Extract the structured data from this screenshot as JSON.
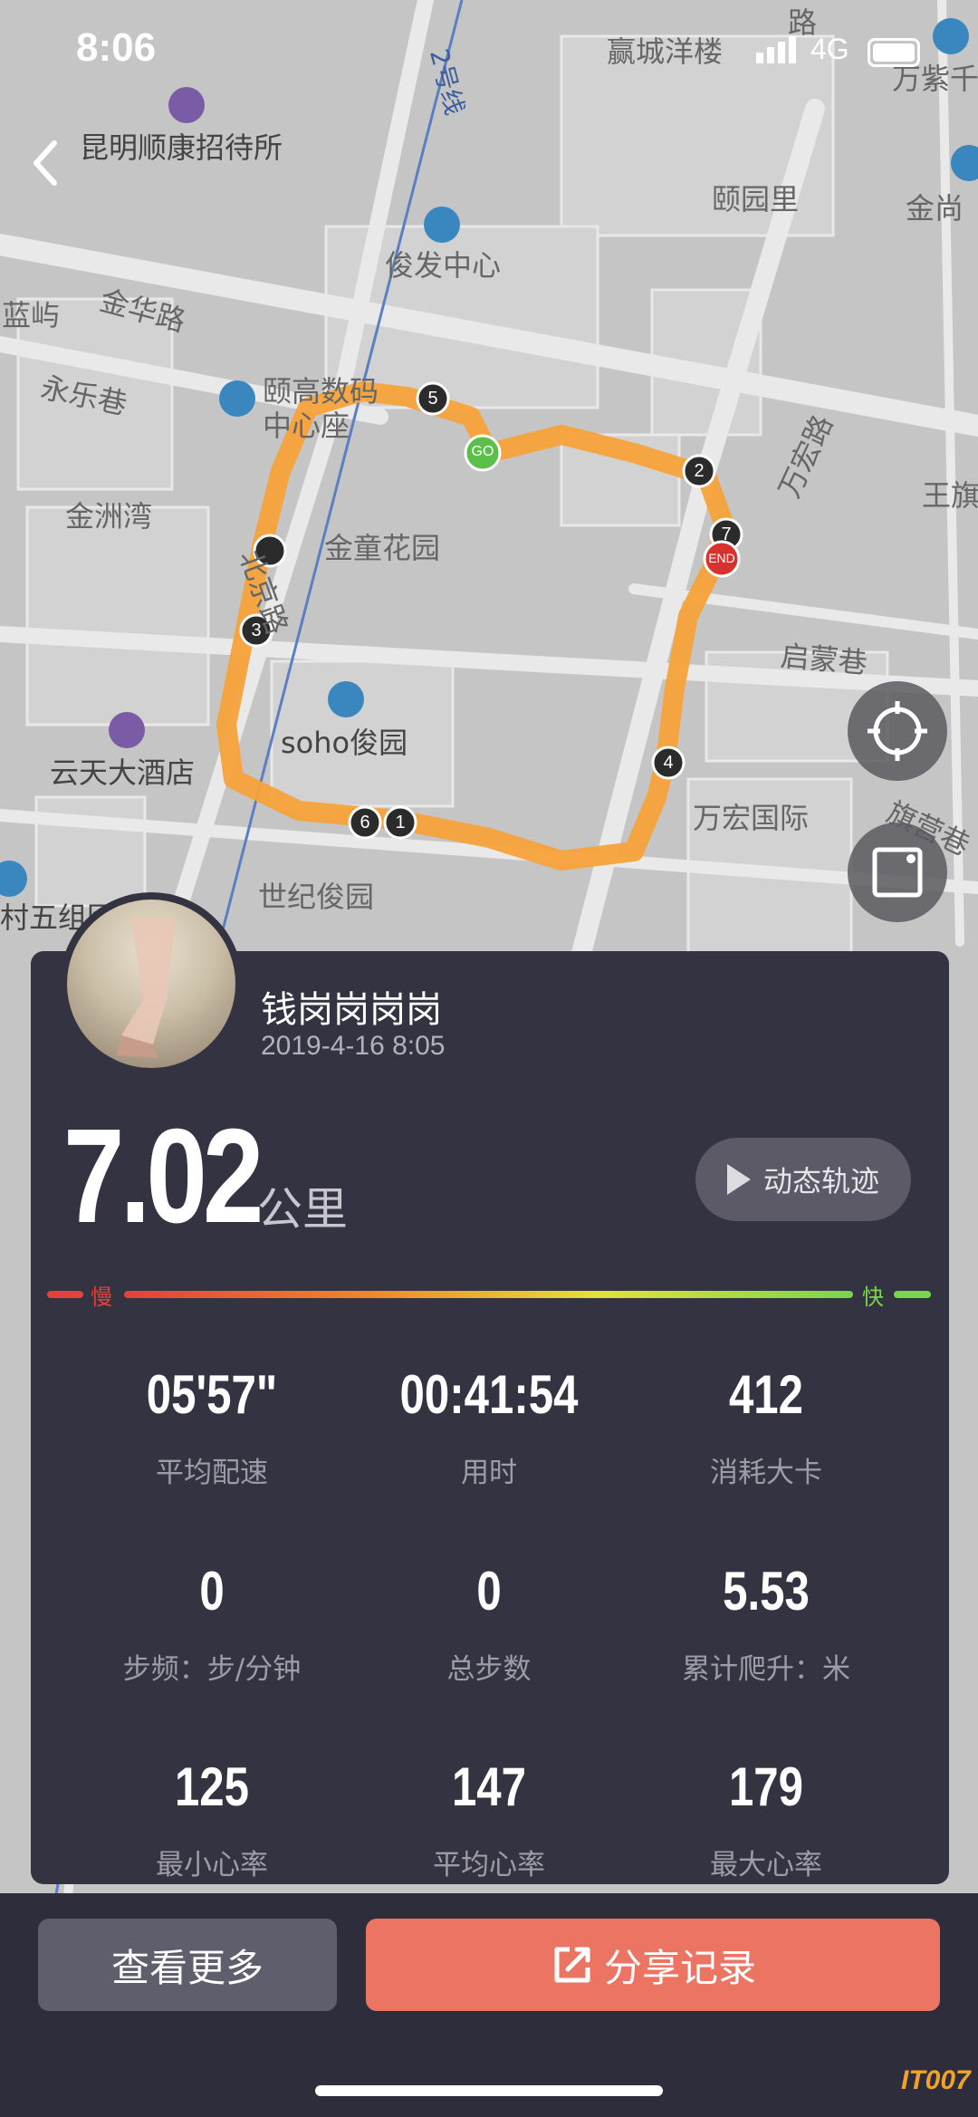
{
  "status_bar": {
    "time": "8:06",
    "network": "4G"
  },
  "map": {
    "labels": [
      "昆明顺康招待所",
      "俊发中心",
      "颐园里",
      "金尚",
      "万紫千",
      "赢城洋楼",
      "蓝屿",
      "金华路",
      "永乐巷",
      "颐高数码",
      "中心座",
      "金童花园",
      "金洲湾",
      "北京路",
      "万宏路",
      "王旗",
      "启蒙巷",
      "soho俊园",
      "云天大酒店",
      "万宏国际",
      "旗营巷",
      "世纪俊园",
      "村五组团",
      "2号线",
      "路"
    ],
    "markers": [
      "GO",
      "END",
      "1",
      "2",
      "3",
      "4",
      "5",
      "6",
      "7"
    ]
  },
  "card": {
    "username": "钱岗岗岗岗",
    "date": "2019-4-16 8:05",
    "distance": "7.02",
    "distance_unit": "公里",
    "replay_label": "动态轨迹",
    "slow_label": "慢",
    "fast_label": "快",
    "stats": [
      {
        "value": "05'57\"",
        "label": "平均配速"
      },
      {
        "value": "00:41:54",
        "label": "用时"
      },
      {
        "value": "412",
        "label": "消耗大卡"
      },
      {
        "value": "0",
        "label": "步频：步/分钟"
      },
      {
        "value": "0",
        "label": "总步数"
      },
      {
        "value": "5.53",
        "label": "累计爬升：米"
      },
      {
        "value": "125",
        "label": "最小心率"
      },
      {
        "value": "147",
        "label": "平均心率"
      },
      {
        "value": "179",
        "label": "最大心率"
      }
    ]
  },
  "buttons": {
    "more": "查看更多",
    "share": "分享记录"
  },
  "watermark": "IT007",
  "colors": {
    "route": "#f7a23a",
    "share": "#ec7463",
    "card": "#343341"
  }
}
